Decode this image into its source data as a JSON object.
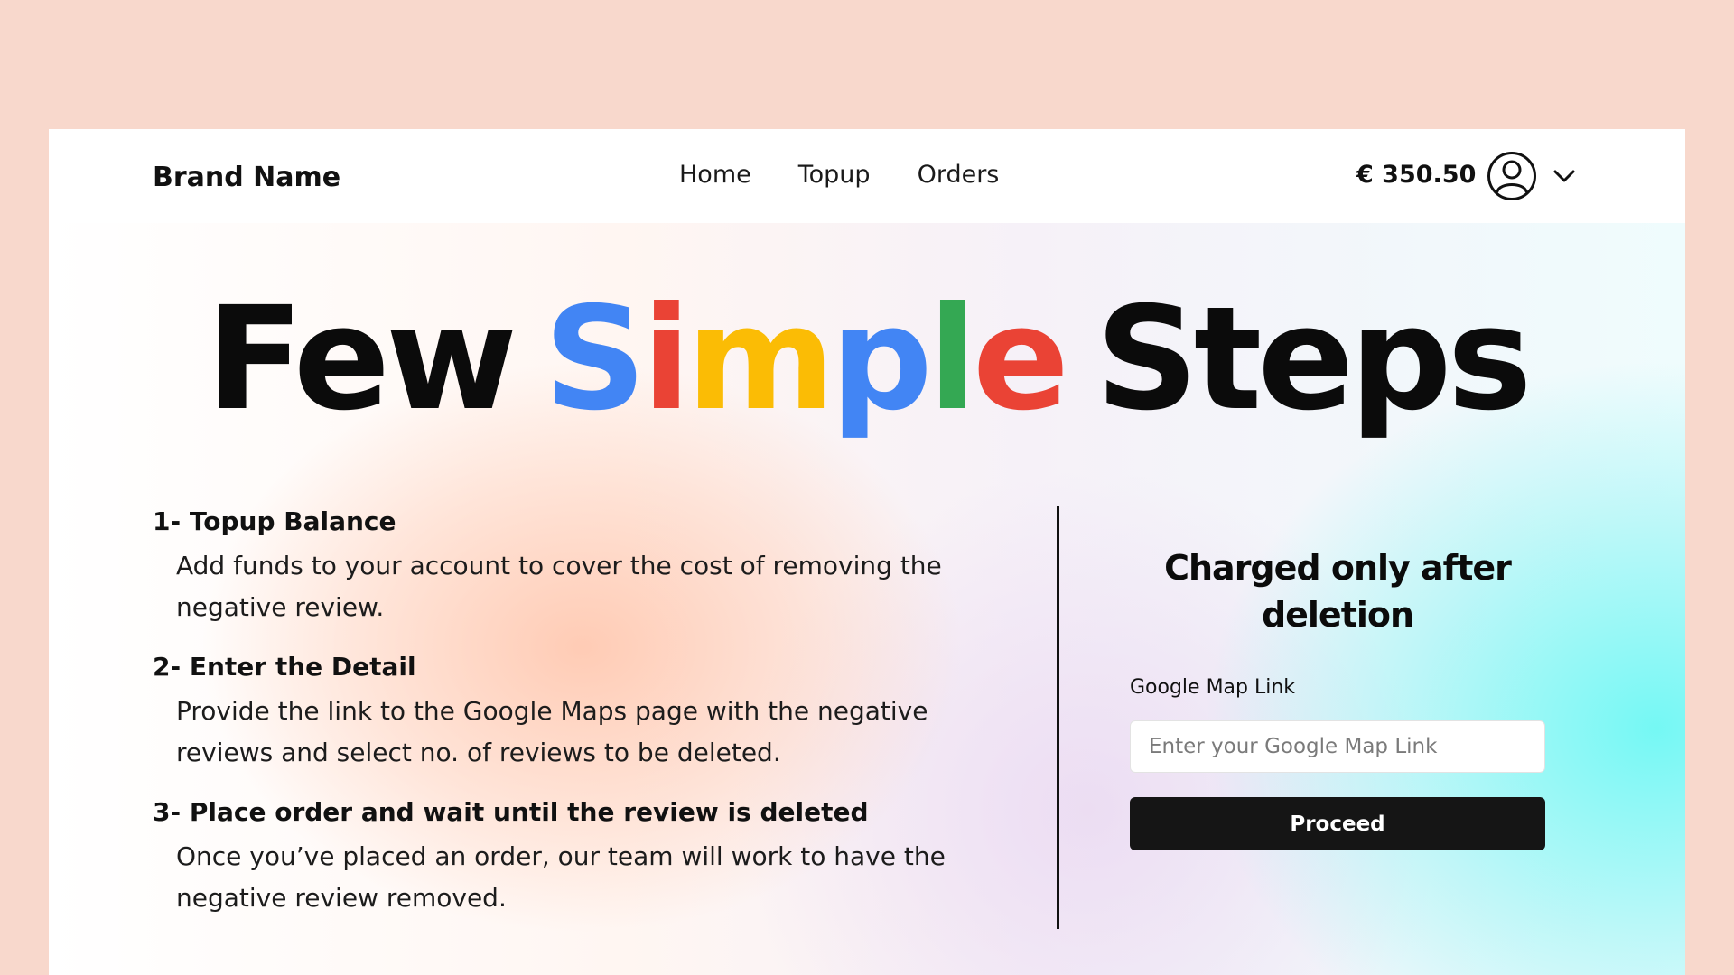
{
  "brand": {
    "name": "Brand Name"
  },
  "nav": {
    "links": [
      {
        "label": "Home"
      },
      {
        "label": "Topup"
      },
      {
        "label": "Orders"
      }
    ]
  },
  "account": {
    "balance": "€ 350.50",
    "avatar_icon": "user-circle-icon",
    "dropdown_icon": "chevron-down-icon"
  },
  "headline": {
    "word1": "Few",
    "word2_letters": [
      "S",
      "i",
      "m",
      "p",
      "l",
      "e"
    ],
    "word2_colors": [
      "#4285F4",
      "#EA4335",
      "#FBBC05",
      "#4285F4",
      "#34A853",
      "#EA4335"
    ],
    "word3": "Steps"
  },
  "steps": [
    {
      "title": "1- Topup Balance",
      "description": "Add funds to your account to cover the cost of removing the negative review."
    },
    {
      "title": "2- Enter the Detail",
      "description": "Provide the link to the Google Maps page with the negative reviews and select no. of reviews to be deleted."
    },
    {
      "title": "3- Place order and wait until the review is deleted",
      "description": "Once you’ve placed an order, our team will work to have the negative review removed."
    }
  ],
  "panel": {
    "title": "Charged only after deletion",
    "field_label": "Google Map Link",
    "input_placeholder": "Enter your Google Map Link",
    "input_value": "",
    "button_label": "Proceed"
  },
  "colors": {
    "page_background": "#F8D8CC",
    "button_background": "#151515",
    "text": "#111111"
  }
}
